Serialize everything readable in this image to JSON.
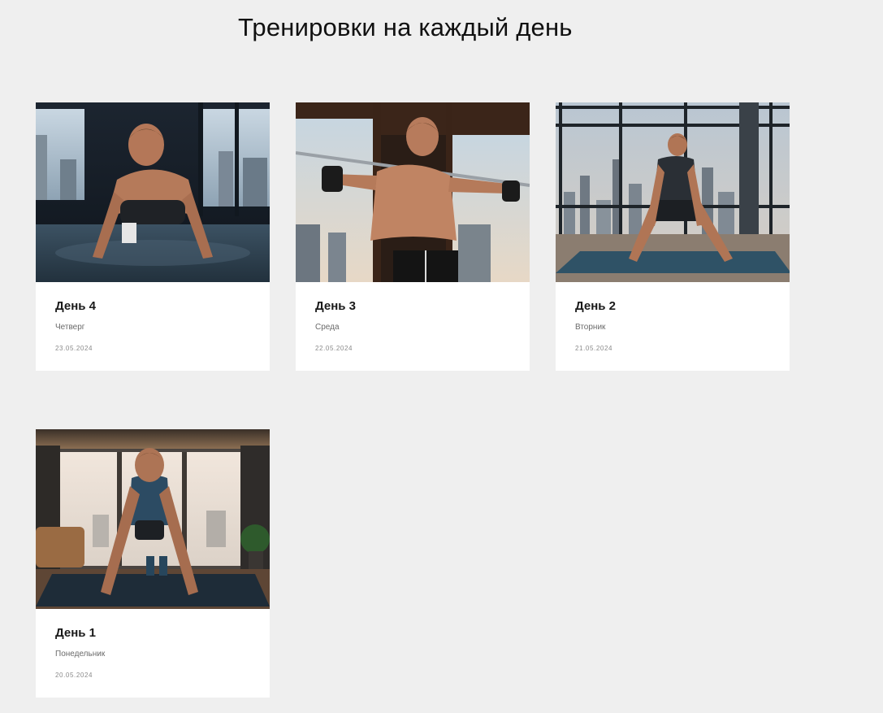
{
  "page": {
    "title": "Тренировки на каждый день"
  },
  "workouts": [
    {
      "title": "День 4",
      "weekday": "Четверг",
      "date": "23.05.2024",
      "image": "man-doing-pushups-near-window"
    },
    {
      "title": "День 3",
      "weekday": "Среда",
      "date": "22.05.2024",
      "image": "shirtless-man-holding-bar-near-window"
    },
    {
      "title": "День 2",
      "weekday": "Вторник",
      "date": "21.05.2024",
      "image": "man-wide-squat-on-mat-city-view"
    },
    {
      "title": "День 1",
      "weekday": "Понедельник",
      "date": "20.05.2024",
      "image": "man-pushups-on-mat-living-room"
    }
  ]
}
